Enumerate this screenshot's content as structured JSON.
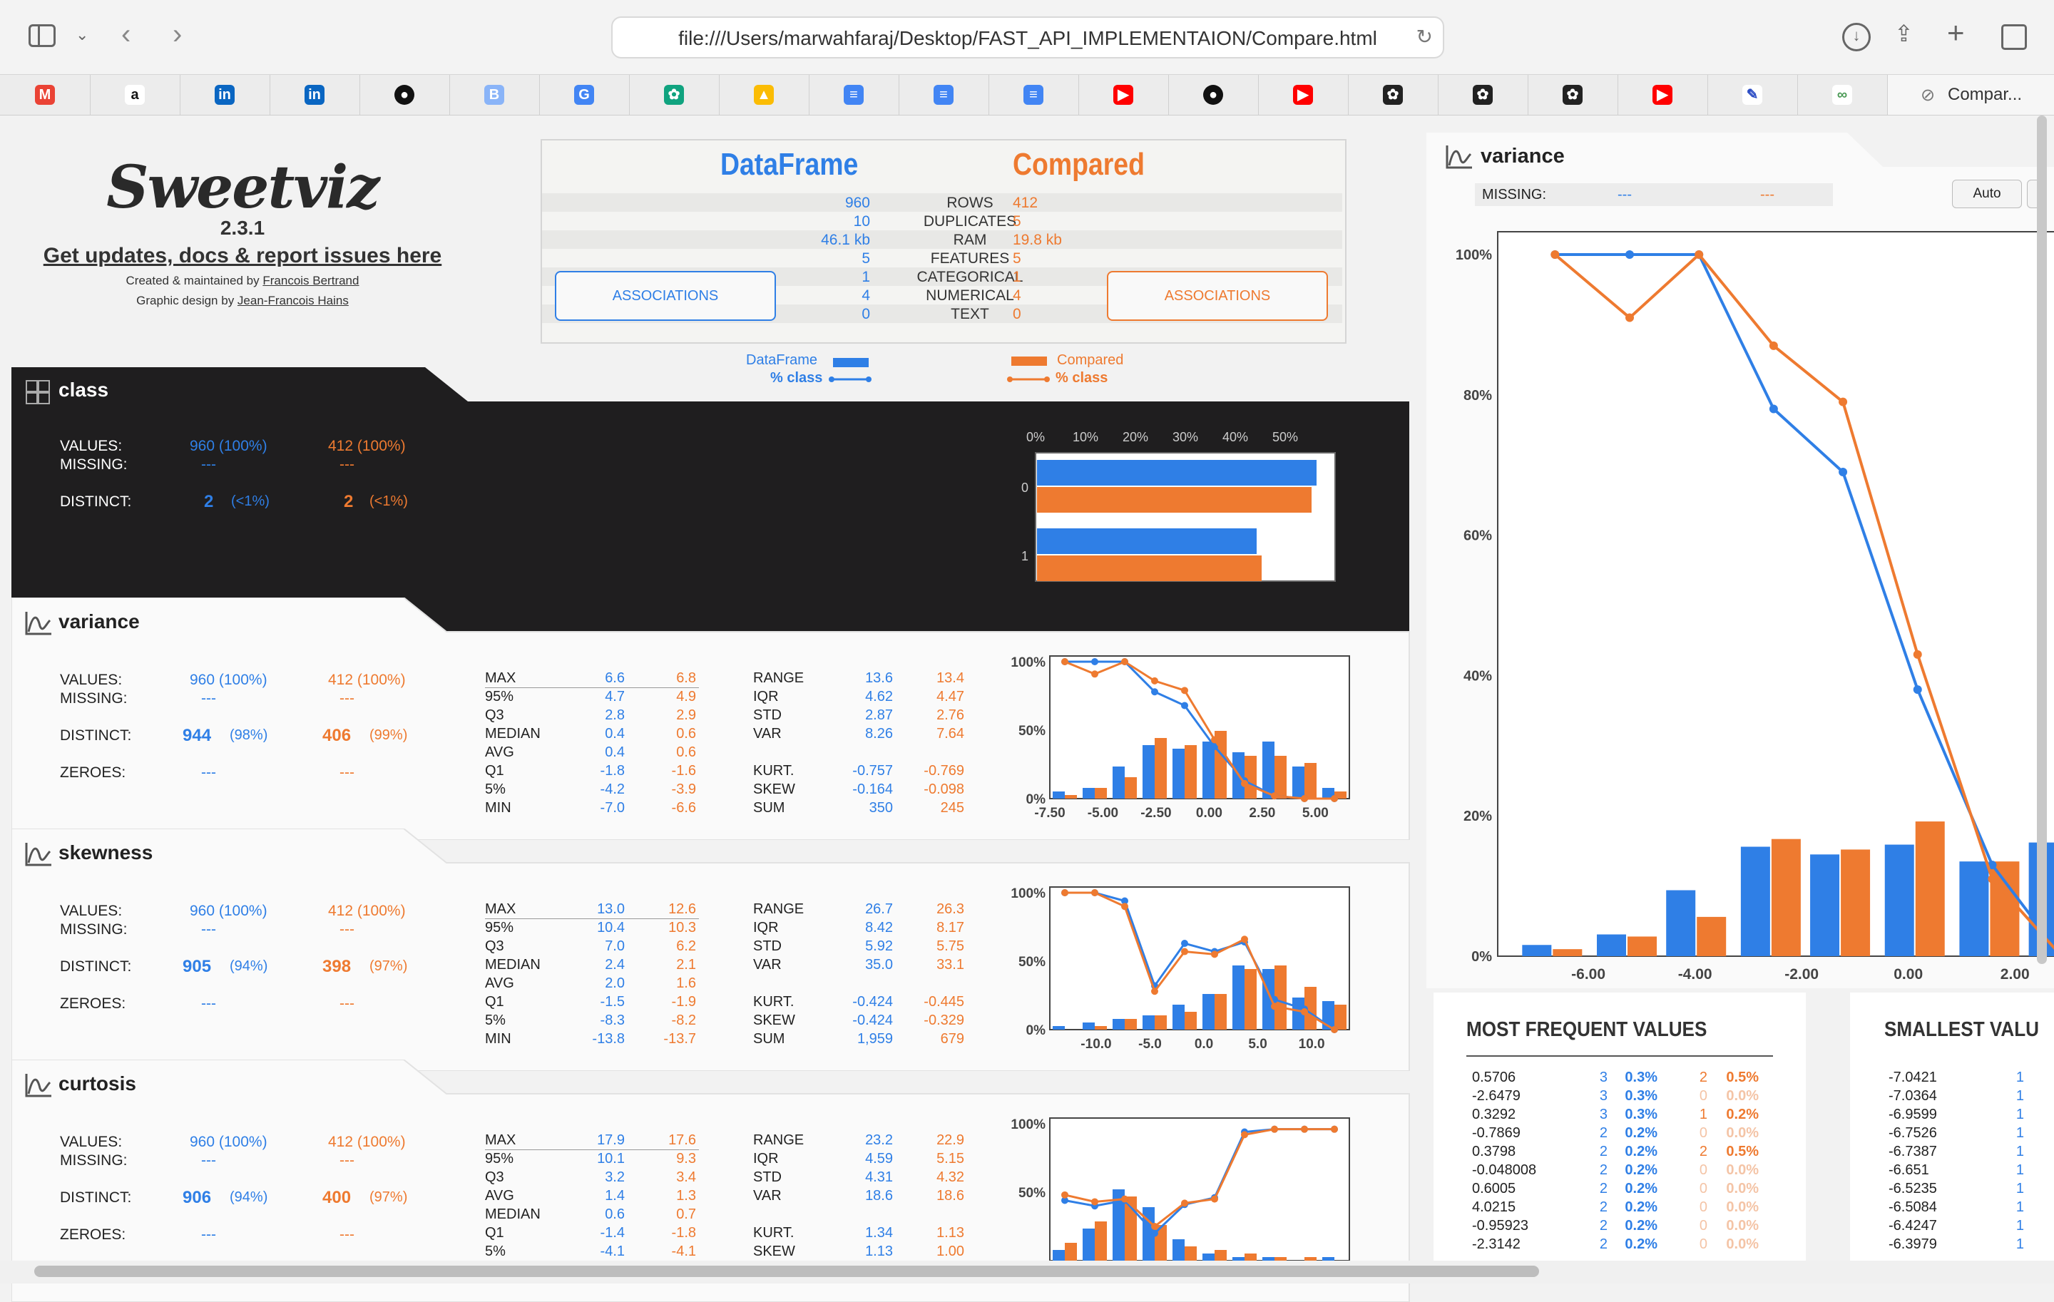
{
  "browser": {
    "url": "file:///Users/marwahfaraj/Desktop/FAST_API_IMPLEMENTAION/Compare.html",
    "tab_title": "Compar...",
    "bookmark_icons": [
      "gmail-icon",
      "amazon-icon",
      "linkedin-icon",
      "linkedin-icon",
      "github-icon",
      "blogger-icon",
      "translate-icon",
      "chatgpt-icon",
      "drive-icon",
      "docs-icon",
      "docs-icon",
      "docs-icon",
      "youtube-icon",
      "github-icon",
      "youtube-icon",
      "chatgpt-icon",
      "chatgpt-icon",
      "chatgpt-icon",
      "youtube-icon",
      "pen-icon",
      "link-icon"
    ]
  },
  "header": {
    "logo": "Sweetviz",
    "version": "2.3.1",
    "updates_link": "Get updates, docs & report issues here",
    "created_prefix": "Created & maintained by ",
    "created_by": "Francois Bertrand",
    "design_prefix": "Graphic design by ",
    "design_by": "Jean-Francois Hains",
    "left_name": "DataFrame",
    "right_name": "Compared",
    "assoc_label": "ASSOCIATIONS",
    "rows": [
      {
        "label": "ROWS",
        "left": "960",
        "right": "412"
      },
      {
        "label": "DUPLICATES",
        "left": "10",
        "right": "5"
      },
      {
        "label": "RAM",
        "left": "46.1 kb",
        "right": "19.8 kb"
      },
      {
        "label": "FEATURES",
        "left": "5",
        "right": "5"
      },
      {
        "label": "CATEGORICAL",
        "left": "1",
        "right": "1"
      },
      {
        "label": "NUMERICAL",
        "left": "4",
        "right": "4"
      },
      {
        "label": "TEXT",
        "left": "0",
        "right": "0"
      }
    ],
    "legend_left_name": "DataFrame",
    "legend_left_pct": "% class",
    "legend_right_name": "Compared",
    "legend_right_pct": "% class"
  },
  "labels": {
    "values": "VALUES:",
    "missing": "MISSING:",
    "distinct": "DISTINCT:",
    "zeroes": "ZEROES:"
  },
  "class_feature": {
    "name": "class",
    "values_left": "960 (100%)",
    "values_right": "412 (100%)",
    "missing_left": "---",
    "missing_right": "---",
    "distinct_left": "2",
    "distinct_left_pct": "(<1%)",
    "distinct_right": "2",
    "distinct_right_pct": "(<1%)"
  },
  "features": [
    {
      "name": "variance",
      "values_left": "960 (100%)",
      "values_right": "412 (100%)",
      "missing_left": "---",
      "missing_right": "---",
      "distinct_left": "944",
      "distinct_left_pct": "(98%)",
      "distinct_right": "406",
      "distinct_right_pct": "(99%)",
      "zeroes_left": "---",
      "zeroes_right": "---",
      "quant": [
        [
          "MAX",
          "6.6",
          "6.8"
        ],
        [
          "95%",
          "4.7",
          "4.9"
        ],
        [
          "Q3",
          "2.8",
          "2.9"
        ],
        [
          "MEDIAN",
          "0.4",
          "0.6"
        ],
        [
          "AVG",
          "0.4",
          "0.6"
        ],
        [
          "Q1",
          "-1.8",
          "-1.6"
        ],
        [
          "5%",
          "-4.2",
          "-3.9"
        ],
        [
          "MIN",
          "-7.0",
          "-6.6"
        ]
      ],
      "stats1": [
        [
          "RANGE",
          "13.6",
          "13.4"
        ],
        [
          "IQR",
          "4.62",
          "4.47"
        ],
        [
          "STD",
          "2.87",
          "2.76"
        ],
        [
          "VAR",
          "8.26",
          "7.64"
        ]
      ],
      "stats2": [
        [
          "KURT.",
          "-0.757",
          "-0.769"
        ],
        [
          "SKEW",
          "-0.164",
          "-0.098"
        ],
        [
          "SUM",
          "350",
          "245"
        ]
      ]
    },
    {
      "name": "skewness",
      "values_left": "960 (100%)",
      "values_right": "412 (100%)",
      "missing_left": "---",
      "missing_right": "---",
      "distinct_left": "905",
      "distinct_left_pct": "(94%)",
      "distinct_right": "398",
      "distinct_right_pct": "(97%)",
      "zeroes_left": "---",
      "zeroes_right": "---",
      "quant": [
        [
          "MAX",
          "13.0",
          "12.6"
        ],
        [
          "95%",
          "10.4",
          "10.3"
        ],
        [
          "Q3",
          "7.0",
          "6.2"
        ],
        [
          "MEDIAN",
          "2.4",
          "2.1"
        ],
        [
          "AVG",
          "2.0",
          "1.6"
        ],
        [
          "Q1",
          "-1.5",
          "-1.9"
        ],
        [
          "5%",
          "-8.3",
          "-8.2"
        ],
        [
          "MIN",
          "-13.8",
          "-13.7"
        ]
      ],
      "stats1": [
        [
          "RANGE",
          "26.7",
          "26.3"
        ],
        [
          "IQR",
          "8.42",
          "8.17"
        ],
        [
          "STD",
          "5.92",
          "5.75"
        ],
        [
          "VAR",
          "35.0",
          "33.1"
        ]
      ],
      "stats2": [
        [
          "KURT.",
          "-0.424",
          "-0.445"
        ],
        [
          "SKEW",
          "-0.424",
          "-0.329"
        ],
        [
          "SUM",
          "1,959",
          "679"
        ]
      ]
    },
    {
      "name": "curtosis",
      "values_left": "960 (100%)",
      "values_right": "412 (100%)",
      "missing_left": "---",
      "missing_right": "---",
      "distinct_left": "906",
      "distinct_left_pct": "(94%)",
      "distinct_right": "400",
      "distinct_right_pct": "(97%)",
      "zeroes_left": "---",
      "zeroes_right": "---",
      "quant": [
        [
          "MAX",
          "17.9",
          "17.6"
        ],
        [
          "95%",
          "10.1",
          "9.3"
        ],
        [
          "Q3",
          "3.2",
          "3.4"
        ],
        [
          "AVG",
          "1.4",
          "1.3"
        ],
        [
          "MEDIAN",
          "0.6",
          "0.7"
        ],
        [
          "Q1",
          "-1.4",
          "-1.8"
        ],
        [
          "5%",
          "-4.1",
          "-4.1"
        ]
      ],
      "stats1": [
        [
          "RANGE",
          "23.2",
          "22.9"
        ],
        [
          "IQR",
          "4.59",
          "5.15"
        ],
        [
          "STD",
          "4.31",
          "4.32"
        ],
        [
          "VAR",
          "18.6",
          "18.6"
        ]
      ],
      "stats2": [
        [
          "KURT.",
          "1.34",
          "1.13"
        ],
        [
          "SKEW",
          "1.13",
          "1.00"
        ]
      ]
    }
  ],
  "detail": {
    "name": "variance",
    "missing_label": "MISSING:",
    "missing_left": "---",
    "missing_right": "---",
    "auto_button": "Auto",
    "mfv_title": "MOST FREQUENT VALUES",
    "smallest_title": "SMALLEST VALU",
    "mfv": [
      [
        "0.5706",
        "3",
        "0.3%",
        "2",
        "0.5%"
      ],
      [
        "-2.6479",
        "3",
        "0.3%",
        "0",
        "0.0%"
      ],
      [
        "0.3292",
        "3",
        "0.3%",
        "1",
        "0.2%"
      ],
      [
        "-0.7869",
        "2",
        "0.2%",
        "0",
        "0.0%"
      ],
      [
        "0.3798",
        "2",
        "0.2%",
        "2",
        "0.5%"
      ],
      [
        "-0.048008",
        "2",
        "0.2%",
        "0",
        "0.0%"
      ],
      [
        "0.6005",
        "2",
        "0.2%",
        "0",
        "0.0%"
      ],
      [
        "4.0215",
        "2",
        "0.2%",
        "0",
        "0.0%"
      ],
      [
        "-0.95923",
        "2",
        "0.2%",
        "0",
        "0.0%"
      ],
      [
        "-2.3142",
        "2",
        "0.2%",
        "0",
        "0.0%"
      ]
    ],
    "smallest": [
      [
        "-7.0421",
        "1"
      ],
      [
        "-7.0364",
        "1"
      ],
      [
        "-6.9599",
        "1"
      ],
      [
        "-6.7526",
        "1"
      ],
      [
        "-6.7387",
        "1"
      ],
      [
        "-6.651",
        "1"
      ],
      [
        "-6.5235",
        "1"
      ],
      [
        "-6.5084",
        "1"
      ],
      [
        "-6.4247",
        "1"
      ],
      [
        "-6.3979",
        "1"
      ]
    ]
  },
  "colors": {
    "left": "#2f7fe6",
    "right": "#ee7a30",
    "dark": "#1f1e1f"
  },
  "chart_data": [
    {
      "id": "class",
      "type": "bar",
      "orientation": "horizontal",
      "categories": [
        "0",
        "1"
      ],
      "series": [
        {
          "name": "DataFrame",
          "values": [
            56,
            44
          ]
        },
        {
          "name": "Compared",
          "values": [
            55,
            45
          ]
        }
      ],
      "xlim": [
        0,
        60
      ],
      "xticks": [
        "0%",
        "10%",
        "20%",
        "30%",
        "40%",
        "50%"
      ]
    },
    {
      "id": "variance-mini",
      "type": "bar",
      "x": [
        -7.0,
        -5.6,
        -4.3,
        -2.9,
        -1.6,
        -0.2,
        1.2,
        2.5,
        3.9,
        5.2
      ],
      "series": [
        {
          "name": "DataFrame",
          "values": [
            2,
            3,
            9,
            15,
            14,
            16,
            13,
            16,
            9,
            3
          ]
        },
        {
          "name": "Compared",
          "values": [
            1,
            3,
            6,
            17,
            15,
            19,
            12,
            12,
            10,
            2
          ]
        }
      ],
      "lines": [
        {
          "name": "% class",
          "values": [
            100,
            100,
            100,
            78,
            68,
            38,
            13,
            2,
            0,
            0
          ]
        },
        {
          "name": "% class",
          "values": [
            100,
            91,
            100,
            86,
            79,
            43,
            11,
            2,
            0,
            0
          ]
        }
      ],
      "xlim": [
        -7.5,
        6.6
      ],
      "xticks": [
        "-7.50",
        "-5.00",
        "-2.50",
        "0.00",
        "2.50",
        "5.00"
      ],
      "yticks": [
        "0%",
        "50%",
        "100%"
      ]
    },
    {
      "id": "skewness-mini",
      "type": "bar",
      "x": [
        -13.8,
        -11.1,
        -8.5,
        -5.8,
        -3.1,
        -0.5,
        2.2,
        4.9,
        7.6,
        10.3
      ],
      "series": [
        {
          "name": "DataFrame",
          "values": [
            1,
            2,
            3,
            4,
            7,
            10,
            18,
            17,
            9,
            8
          ]
        },
        {
          "name": "Compared",
          "values": [
            0,
            1,
            3,
            4,
            5,
            10,
            17,
            18,
            12,
            7
          ]
        }
      ],
      "lines": [
        {
          "name": "% class",
          "values": [
            100,
            100,
            94,
            32,
            63,
            57,
            64,
            22,
            15,
            0
          ]
        },
        {
          "name": "% class",
          "values": [
            100,
            100,
            90,
            28,
            57,
            55,
            66,
            17,
            13,
            0
          ]
        }
      ],
      "xlim": [
        -14.3,
        13.5
      ],
      "xticks": [
        "-10.0",
        "-5.0",
        "0.0",
        "5.0",
        "10.0"
      ],
      "yticks": [
        "0%",
        "50%",
        "100%"
      ]
    },
    {
      "id": "curtosis-mini",
      "type": "bar",
      "x": [
        -5.3,
        -3.0,
        -0.7,
        1.6,
        3.9,
        6.2,
        8.5,
        10.8,
        13.1,
        15.4
      ],
      "series": [
        {
          "name": "DataFrame",
          "values": [
            3,
            9,
            20,
            15,
            6,
            2,
            1,
            1,
            0,
            1
          ]
        },
        {
          "name": "Compared",
          "values": [
            5,
            11,
            18,
            10,
            4,
            3,
            2,
            1,
            1,
            0
          ]
        }
      ],
      "lines": [
        {
          "name": "% class",
          "values": [
            44,
            40,
            44,
            20,
            41,
            46,
            94,
            96,
            96,
            96
          ]
        },
        {
          "name": "% class",
          "values": [
            48,
            43,
            45,
            25,
            42,
            45,
            92,
            96,
            96,
            96
          ]
        }
      ],
      "xlim": [
        -5.8,
        17.9
      ],
      "yticks": [
        "50%",
        "100%"
      ]
    },
    {
      "id": "variance-detail",
      "type": "bar",
      "x": [
        -7.0,
        -5.6,
        -4.3,
        -2.9,
        -1.6,
        -0.2,
        1.2,
        2.5
      ],
      "series": [
        {
          "name": "DataFrame",
          "values": [
            1.6,
            3.1,
            9.4,
            15.6,
            14.5,
            15.9,
            13.5,
            16.2
          ]
        },
        {
          "name": "Compared",
          "values": [
            1.0,
            2.8,
            5.6,
            16.7,
            15.2,
            19.2,
            13.5,
            15.0
          ]
        }
      ],
      "lines": [
        {
          "name": "% class",
          "values": [
            100,
            100,
            100,
            78,
            69,
            38,
            13,
            0
          ]
        },
        {
          "name": "% class",
          "values": [
            100,
            91,
            100,
            87,
            79,
            43,
            11,
            0
          ]
        }
      ],
      "xlim": [
        -7.7,
        3.0
      ],
      "xticks": [
        "-6.00",
        "-4.00",
        "-2.00",
        "0.00",
        "2.00"
      ],
      "yticks": [
        "0%",
        "20%",
        "40%",
        "60%",
        "80%",
        "100%"
      ]
    }
  ]
}
